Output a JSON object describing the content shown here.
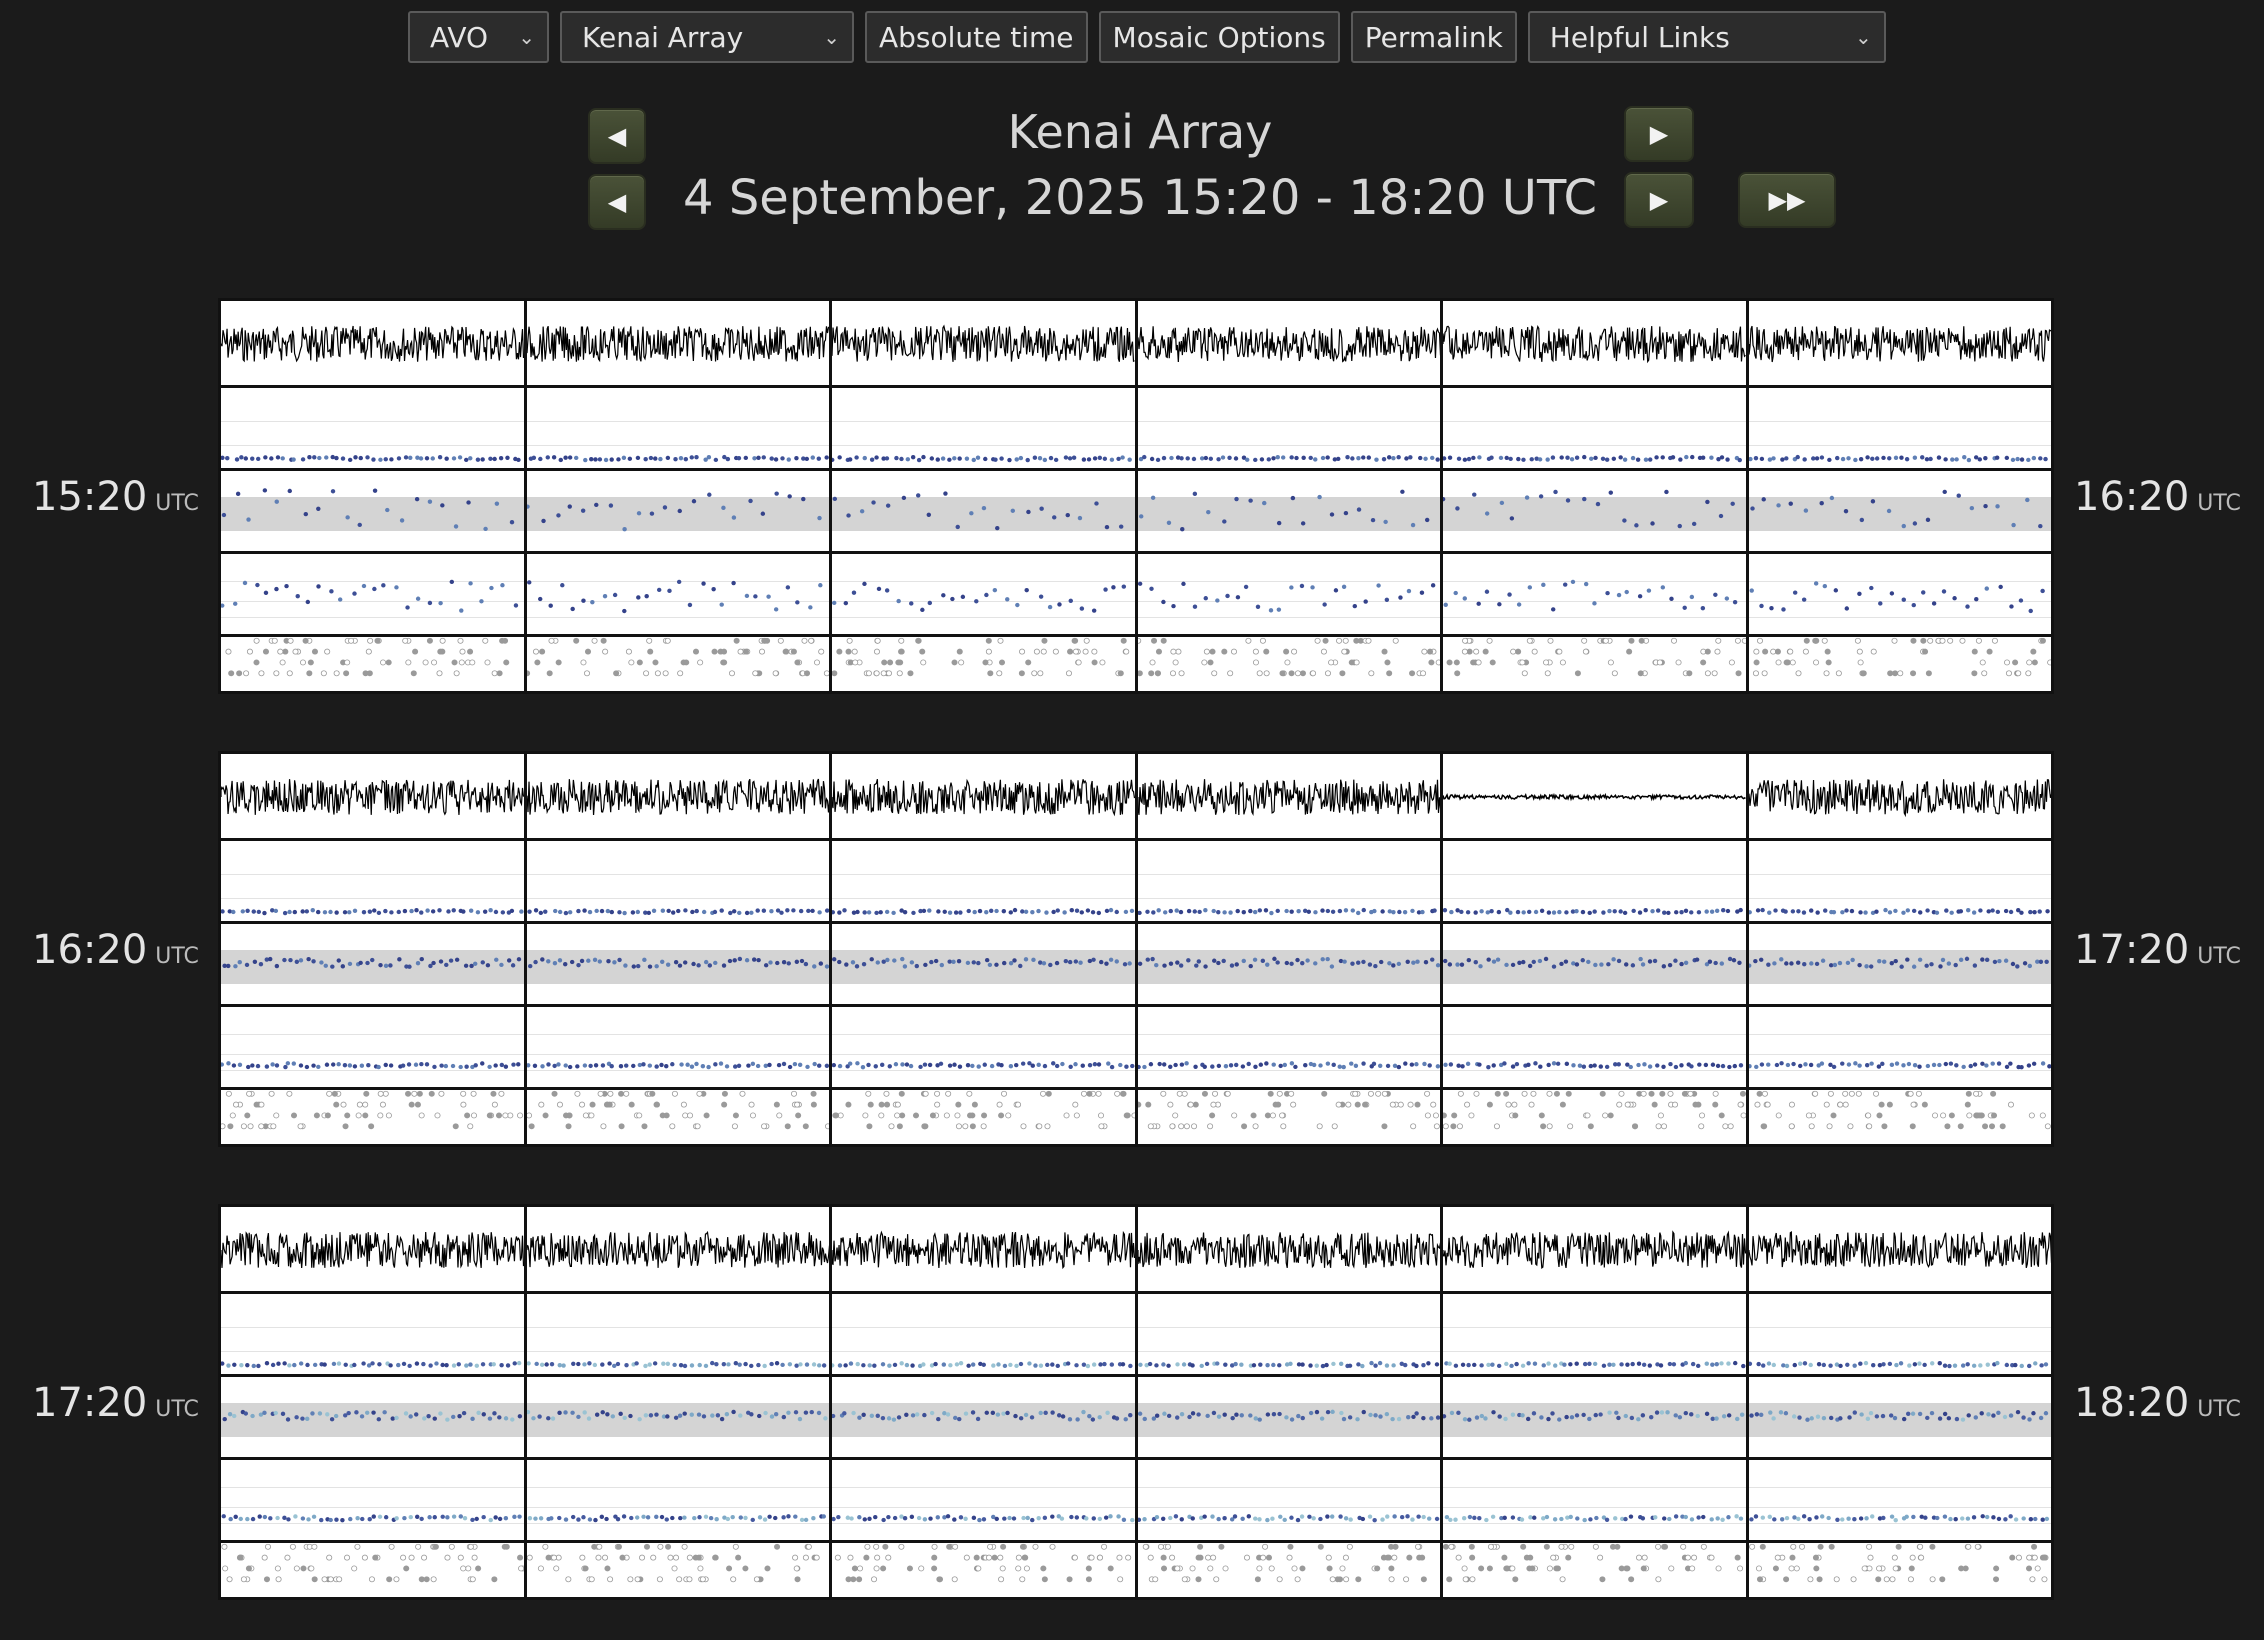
{
  "toolbar": {
    "network": "AVO",
    "subnet": "Kenai Array",
    "time_mode": "Absolute time",
    "mosaic_options": "Mosaic Options",
    "permalink": "Permalink",
    "helpful_links": "Helpful Links"
  },
  "header": {
    "title": "Kenai Array",
    "time_range": "4 September, 2025 15:20 - 18:20 UTC"
  },
  "rows": [
    {
      "start": "15:20",
      "end": "16:20",
      "utc": "UTC"
    },
    {
      "start": "16:20",
      "end": "17:20",
      "utc": "UTC"
    },
    {
      "start": "17:20",
      "end": "18:20",
      "utc": "UTC"
    }
  ]
}
